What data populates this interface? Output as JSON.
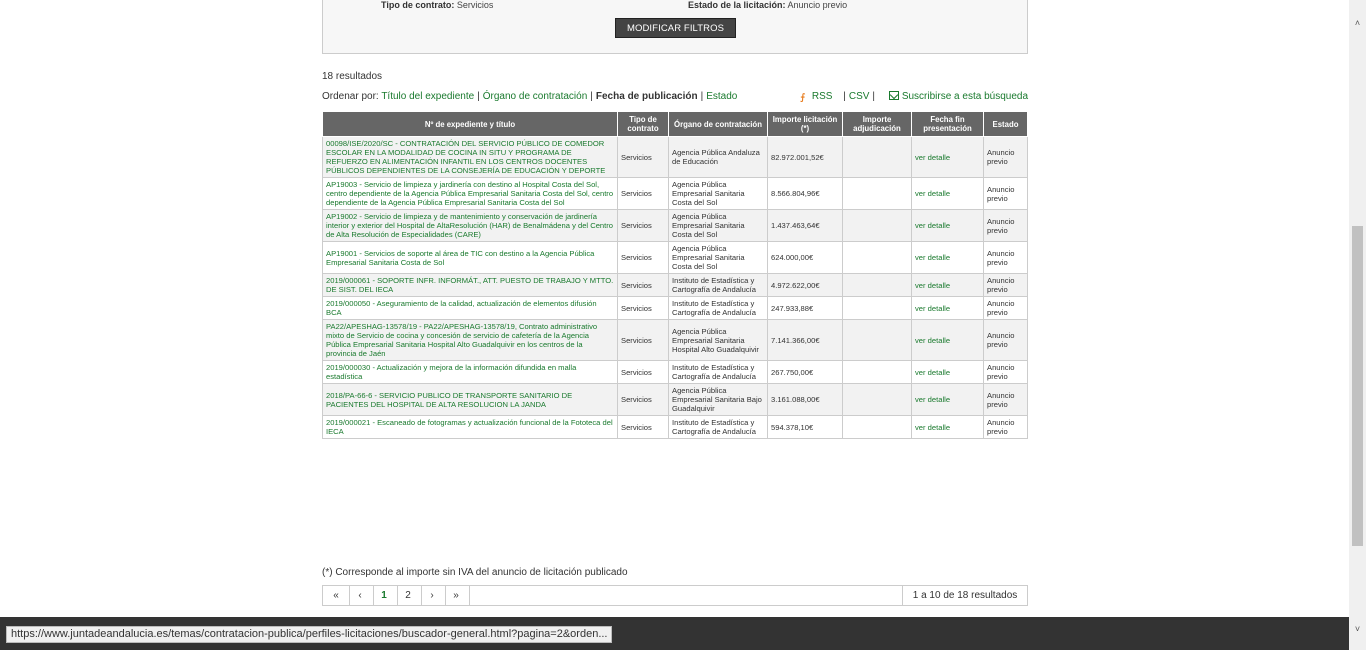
{
  "filters": {
    "contract_type_label": "Tipo de contrato:",
    "contract_type_value": "Servicios",
    "status_label": "Estado de la licitación:",
    "status_value": "Anuncio previo",
    "modify_button": "MODIFICAR FILTROS"
  },
  "results_count": "18 resultados",
  "sort": {
    "label": "Ordenar por:",
    "options": [
      "Título del expediente",
      "Órgano de contratación",
      "Fecha de publicación",
      "Estado"
    ],
    "active": "Fecha de publicación",
    "rss": "RSS",
    "csv": "CSV",
    "subscribe": "Suscribirse a esta búsqueda"
  },
  "table": {
    "headers": [
      "Nº de expediente y título",
      "Tipo de contrato",
      "Órgano de contratación",
      "Importe licitación (*)",
      "Importe adjudicación",
      "Fecha fin presentación",
      "Estado"
    ],
    "rows": [
      {
        "title": "00098/ISE/2020/SC - CONTRATACIÓN DEL SERVICIO PÚBLICO DE COMEDOR ESCOLAR EN LA MODALIDAD DE COCINA IN SITU Y PROGRAMA DE REFUERZO EN ALIMENTACIÓN INFANTIL EN LOS CENTROS DOCENTES PÚBLICOS DEPENDIENTES DE LA CONSEJERÍA DE EDUCACIÓN Y DEPORTE",
        "tipo": "Servicios",
        "organo": "Agencia Pública Andaluza de Educación",
        "importe": "82.972.001,52€",
        "adjudicacion": "",
        "fecha": "ver detalle",
        "estado": "Anuncio previo"
      },
      {
        "title": "AP19003 - Servicio de limpieza y jardinería con destino al Hospital Costa del Sol, centro dependiente de la Agencia Pública Empresarial Sanitaria Costa del Sol, centro dependiente de la Agencia Pública Empresarial Sanitaria Costa del Sol",
        "tipo": "Servicios",
        "organo": "Agencia Pública Empresarial Sanitaria Costa del Sol",
        "importe": "8.566.804,96€",
        "adjudicacion": "",
        "fecha": "ver detalle",
        "estado": "Anuncio previo"
      },
      {
        "title": "AP19002 - Servicio de limpieza y de mantenimiento y conservación de jardinería interior y exterior del Hospital de AltaResolución (HAR) de Benalmádena y del Centro de Alta Resolución de Especialidades (CARE)",
        "tipo": "Servicios",
        "organo": "Agencia Pública Empresarial Sanitaria Costa del Sol",
        "importe": "1.437.463,64€",
        "adjudicacion": "",
        "fecha": "ver detalle",
        "estado": "Anuncio previo"
      },
      {
        "title": "AP19001 - Servicios de soporte al área de TIC con destino a la Agencia Pública Empresarial Sanitaria Costa de Sol",
        "tipo": "Servicios",
        "organo": "Agencia Pública Empresarial Sanitaria Costa del Sol",
        "importe": "624.000,00€",
        "adjudicacion": "",
        "fecha": "ver detalle",
        "estado": "Anuncio previo"
      },
      {
        "title": "2019/000061 - SOPORTE INFR. INFORMÁT., ATT. PUESTO DE TRABAJO Y MTTO. DE SIST. DEL IECA",
        "tipo": "Servicios",
        "organo": "Instituto de Estadística y Cartografía de Andalucía",
        "importe": "4.972.622,00€",
        "adjudicacion": "",
        "fecha": "ver detalle",
        "estado": "Anuncio previo"
      },
      {
        "title": "2019/000050 - Aseguramiento de la calidad, actualización de elementos difusión BCA",
        "tipo": "Servicios",
        "organo": "Instituto de Estadística y Cartografía de Andalucía",
        "importe": "247.933,88€",
        "adjudicacion": "",
        "fecha": "ver detalle",
        "estado": "Anuncio previo"
      },
      {
        "title": "PA22/APESHAG-13578/19 - PA22/APESHAG-13578/19, Contrato administrativo mixto de Servicio de cocina y concesión de servicio de cafetería de la Agencia Pública Empresarial Sanitaria Hospital Alto Guadalquivir en los centros de la provincia de Jaén",
        "tipo": "Servicios",
        "organo": "Agencia Pública Empresarial Sanitaria Hospital Alto Guadalquivir",
        "importe": "7.141.366,00€",
        "adjudicacion": "",
        "fecha": "ver detalle",
        "estado": "Anuncio previo"
      },
      {
        "title": "2019/000030 - Actualización y mejora de la información difundida en malla estadística",
        "tipo": "Servicios",
        "organo": "Instituto de Estadística y Cartografía de Andalucía",
        "importe": "267.750,00€",
        "adjudicacion": "",
        "fecha": "ver detalle",
        "estado": "Anuncio previo"
      },
      {
        "title": "2018/PA-66-6 - SERVICIO PUBLICO DE TRANSPORTE SANITARIO DE PACIENTES DEL HOSPITAL DE ALTA RESOLUCION LA JANDA",
        "tipo": "Servicios",
        "organo": "Agencia Pública Empresarial Sanitaria Bajo Guadalquivir",
        "importe": "3.161.088,00€",
        "adjudicacion": "",
        "fecha": "ver detalle",
        "estado": "Anuncio previo"
      },
      {
        "title": "2019/000021 - Escaneado de fotogramas y actualización funcional de la Fototeca del IECA",
        "tipo": "Servicios",
        "organo": "Instituto de Estadística y Cartografía de Andalucía",
        "importe": "594.378,10€",
        "adjudicacion": "",
        "fecha": "ver detalle",
        "estado": "Anuncio previo"
      }
    ]
  },
  "footnote": "(*) Corresponde al importe sin IVA del anuncio de licitación publicado",
  "pager": {
    "first": "«",
    "prev": "‹",
    "pages": [
      "1",
      "2"
    ],
    "current": "1",
    "next": "›",
    "last": "»",
    "summary": "1 a 10 de 18 resultados"
  },
  "status_url": "https://www.juntadeandalucia.es/temas/contratacion-publica/perfiles-licitaciones/buscador-general.html?pagina=2&orden...",
  "colors": {
    "link": "#1a7a2e",
    "header_bg": "#666666",
    "button_bg": "#444444",
    "footer_bg": "#333333"
  }
}
